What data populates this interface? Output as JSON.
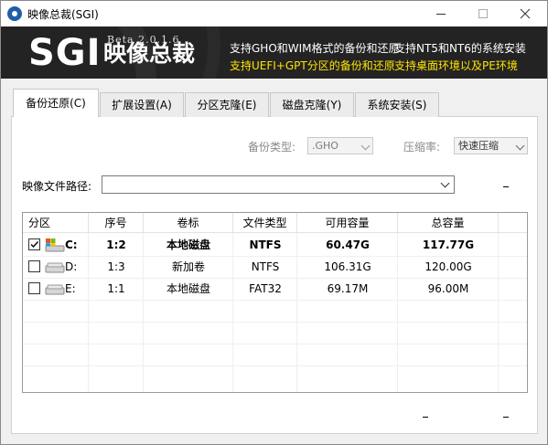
{
  "window": {
    "title": "映像总裁(SGI)",
    "minimize_glyph": "─",
    "maximize_glyph": "☐",
    "close_glyph": "✕"
  },
  "banner": {
    "logo_text": "SGI",
    "logo_cn": "映像总裁",
    "version": "Beta 2.0.1.6",
    "features_white": [
      "支持GHO和WIM格式的备份和还原",
      "支持NT5和NT6的系统安装"
    ],
    "features_yellow": [
      "支持UEFI+GPT分区的备份和还原",
      "支持桌面环境以及PE环境"
    ],
    "colors": {
      "bg": "#232323",
      "white": "#ffffff",
      "yellow": "#ffe400"
    }
  },
  "tabs": [
    {
      "label": "备份还原(C)",
      "active": true
    },
    {
      "label": "扩展设置(A)",
      "active": false
    },
    {
      "label": "分区克隆(E)",
      "active": false
    },
    {
      "label": "磁盘克隆(Y)",
      "active": false
    },
    {
      "label": "系统安装(S)",
      "active": false
    }
  ],
  "options": {
    "backup_type_label": "备份类型:",
    "backup_type_value": ".GHO",
    "compression_label": "压缩率:",
    "compression_value": "快速压缩",
    "image_path_label": "映像文件路径:",
    "image_path_value": "",
    "dash_glyph": "-"
  },
  "table": {
    "columns": [
      "分区",
      "序号",
      "卷标",
      "文件类型",
      "可用容量",
      "总容量"
    ],
    "rows": [
      {
        "checked": true,
        "bold": true,
        "drive": "C:",
        "icon": "system-drive-icon",
        "index": "1:2",
        "label": "本地磁盘",
        "fs": "NTFS",
        "free": "60.47G",
        "total": "117.77G"
      },
      {
        "checked": false,
        "bold": false,
        "drive": "D:",
        "icon": "drive-icon",
        "index": "1:3",
        "label": "新加卷",
        "fs": "NTFS",
        "free": "106.31G",
        "total": "120.00G"
      },
      {
        "checked": false,
        "bold": false,
        "drive": "E:",
        "icon": "drive-icon",
        "index": "1:1",
        "label": "本地磁盘",
        "fs": "FAT32",
        "free": "69.17M",
        "total": "96.00M"
      }
    ]
  },
  "footer": {
    "dash_left": "-",
    "dash_right": "-"
  }
}
